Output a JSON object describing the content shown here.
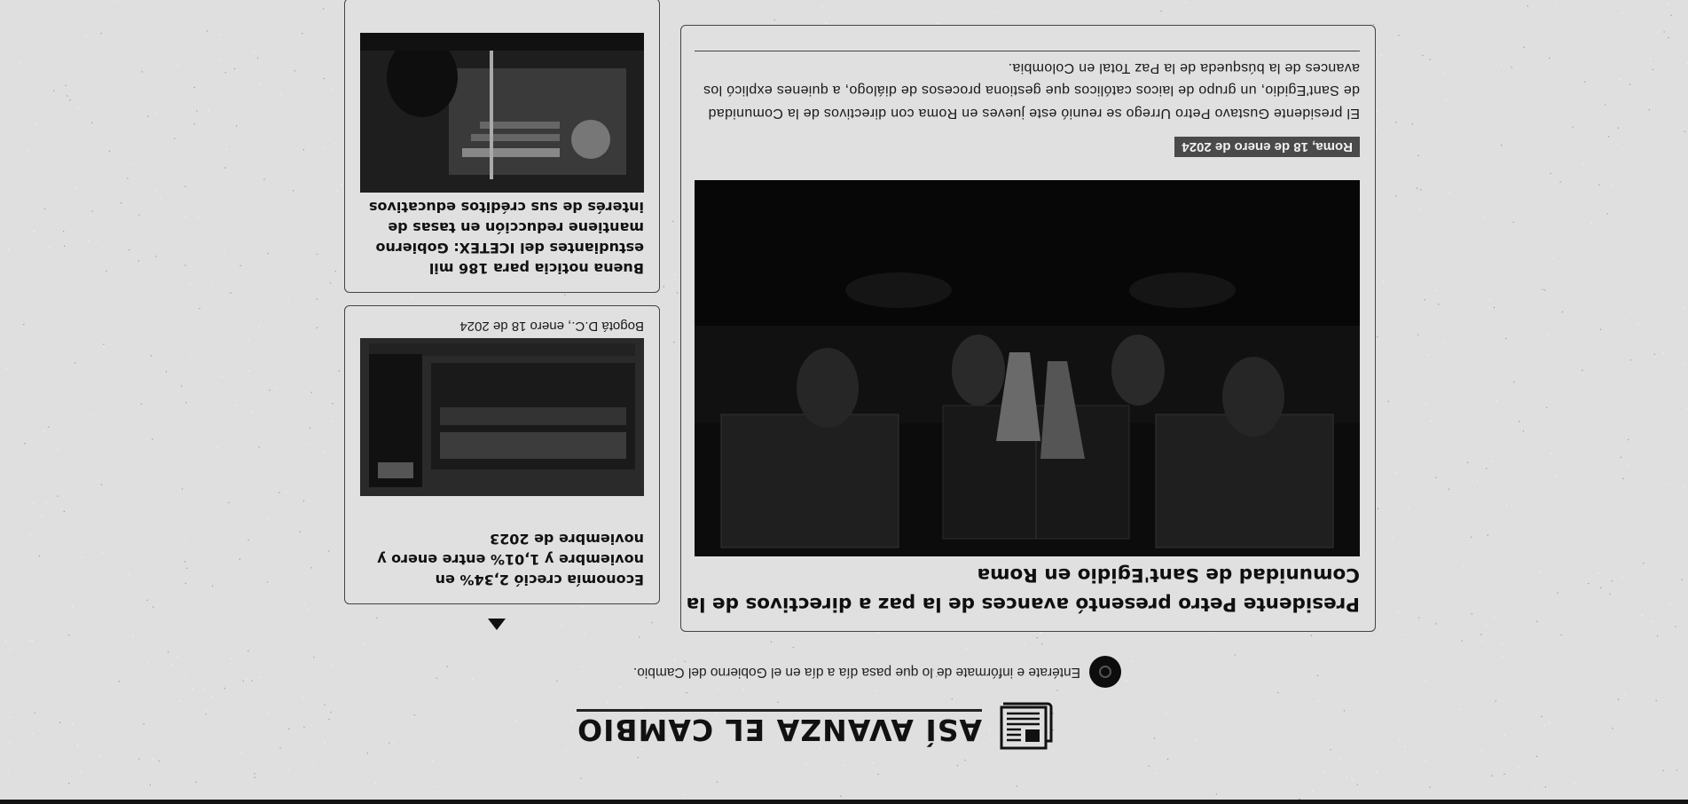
{
  "header": {
    "title": "ASÍ AVANZA EL CAMBIO",
    "icon": "newspaper-icon",
    "subtitle": "Entérate e infórmate de lo que pasa día a día en el Gobierno del Cambio."
  },
  "main_article": {
    "title": "Presidente Petro presentó avances de la paz a directivos de la Comunidad de Sant'Egidio en Roma",
    "date": "Roma, 18 de enero de 2024",
    "body": "El presidente Gustavo Petro Urrego se reunió este jueves en Roma con directivos de la Comunidad de Sant'Egidio, un grupo de laicos católicos que gestiona procesos de diálogo, a quienes explicó los avances de la búsqueda de la Paz Total en Colombia."
  },
  "side_articles": [
    {
      "title": "Economía creció 2,34% en noviembre y 1,01% entre enero y noviembre de 2023",
      "date": "Bogotá D.C., enero 18 de 2024"
    },
    {
      "title": "Buena noticia para 186 mil estudiantes del ICETEX: Gobierno mantiene reducción en tasas de interés de sus créditos educativos",
      "date": ""
    }
  ],
  "nav": {
    "up_icon": "triangle-up-icon",
    "down_icon": "triangle-down-icon"
  }
}
